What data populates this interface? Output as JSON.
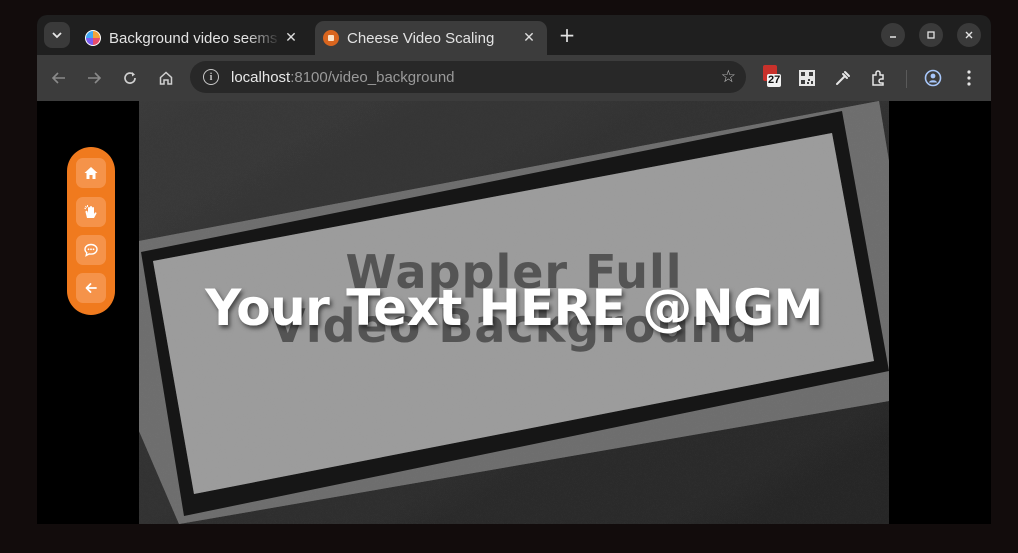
{
  "browser": {
    "tabs": [
      {
        "title": "Background video seems",
        "favicon": "colorful-logo-icon",
        "active": false
      },
      {
        "title": "Cheese Video Scaling",
        "favicon": "cheese-site-icon",
        "active": true
      }
    ],
    "new_tab_label": "+",
    "address": {
      "host": "localhost",
      "path": ":8100/video_background"
    },
    "extension_badge": "27"
  },
  "page": {
    "headline": "Your Text HERE @NGM",
    "video_text_line1": "Wappler Full",
    "video_text_line2": "Video Background",
    "nav_items": [
      {
        "name": "home-icon"
      },
      {
        "name": "clapping-hands-icon"
      },
      {
        "name": "chat-bubble-icon"
      },
      {
        "name": "arrow-left-icon"
      }
    ]
  },
  "colors": {
    "accent": "#f07a1e",
    "accent_button": "#f5934a",
    "tab_active": "#3c3c3c",
    "tabstrip": "#1f1f1f"
  }
}
